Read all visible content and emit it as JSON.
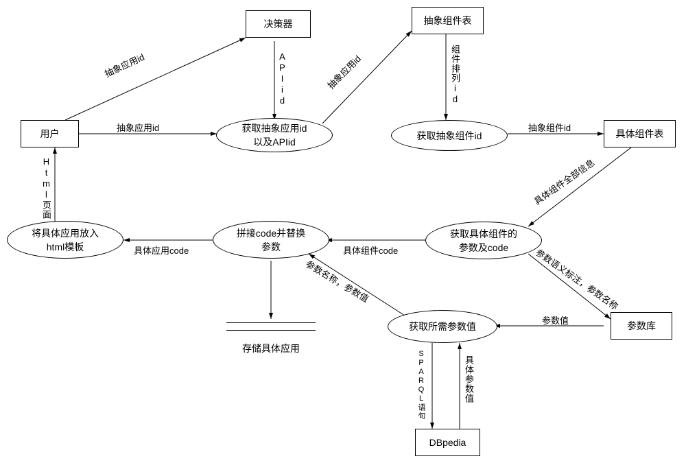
{
  "nodes": {
    "user": "用户",
    "decider": "决策器",
    "abstract_component_table": "抽象组件表",
    "concrete_component_table": "具体组件表",
    "param_store": "参数库",
    "dbpedia": "DBpedia",
    "get_abstract_app_api": "获取抽象应用id\n以及APIid",
    "get_abstract_component_id": "获取抽象组件id",
    "get_concrete_component": "获取具体组件的\n参数及code",
    "get_param_values": "获取所需参数值",
    "concat_code_replace": "拼接code并替换\n参数",
    "put_into_template": "将具体应用放入\nhtml模板",
    "store_concrete_app": "存储具体应用"
  },
  "edges": {
    "user_to_decider": "抽象应用id",
    "user_to_get_abstract_app_api": "抽象应用id",
    "decider_to_get_abstract_app_api": "APIid",
    "get_abstract_app_api_to_table": "抽象应用id",
    "table_to_get_abstract_component": "组件排列id",
    "get_abstract_component_to_concrete_table": "抽象组件id",
    "concrete_table_to_get_concrete": "具体组件全部信息",
    "get_concrete_to_param_store": "参数语义标注，参数名称",
    "param_store_to_get_param_values": "参数值",
    "get_param_values_to_dbpedia_down": "SPARQL语句",
    "dbpedia_to_get_param_values_up": "具体参数值",
    "get_param_values_to_concat": "参数名称，参数值",
    "get_concrete_to_concat": "具体组件code",
    "concat_to_put_template": "具体应用code",
    "put_template_to_user": "Html页面"
  }
}
